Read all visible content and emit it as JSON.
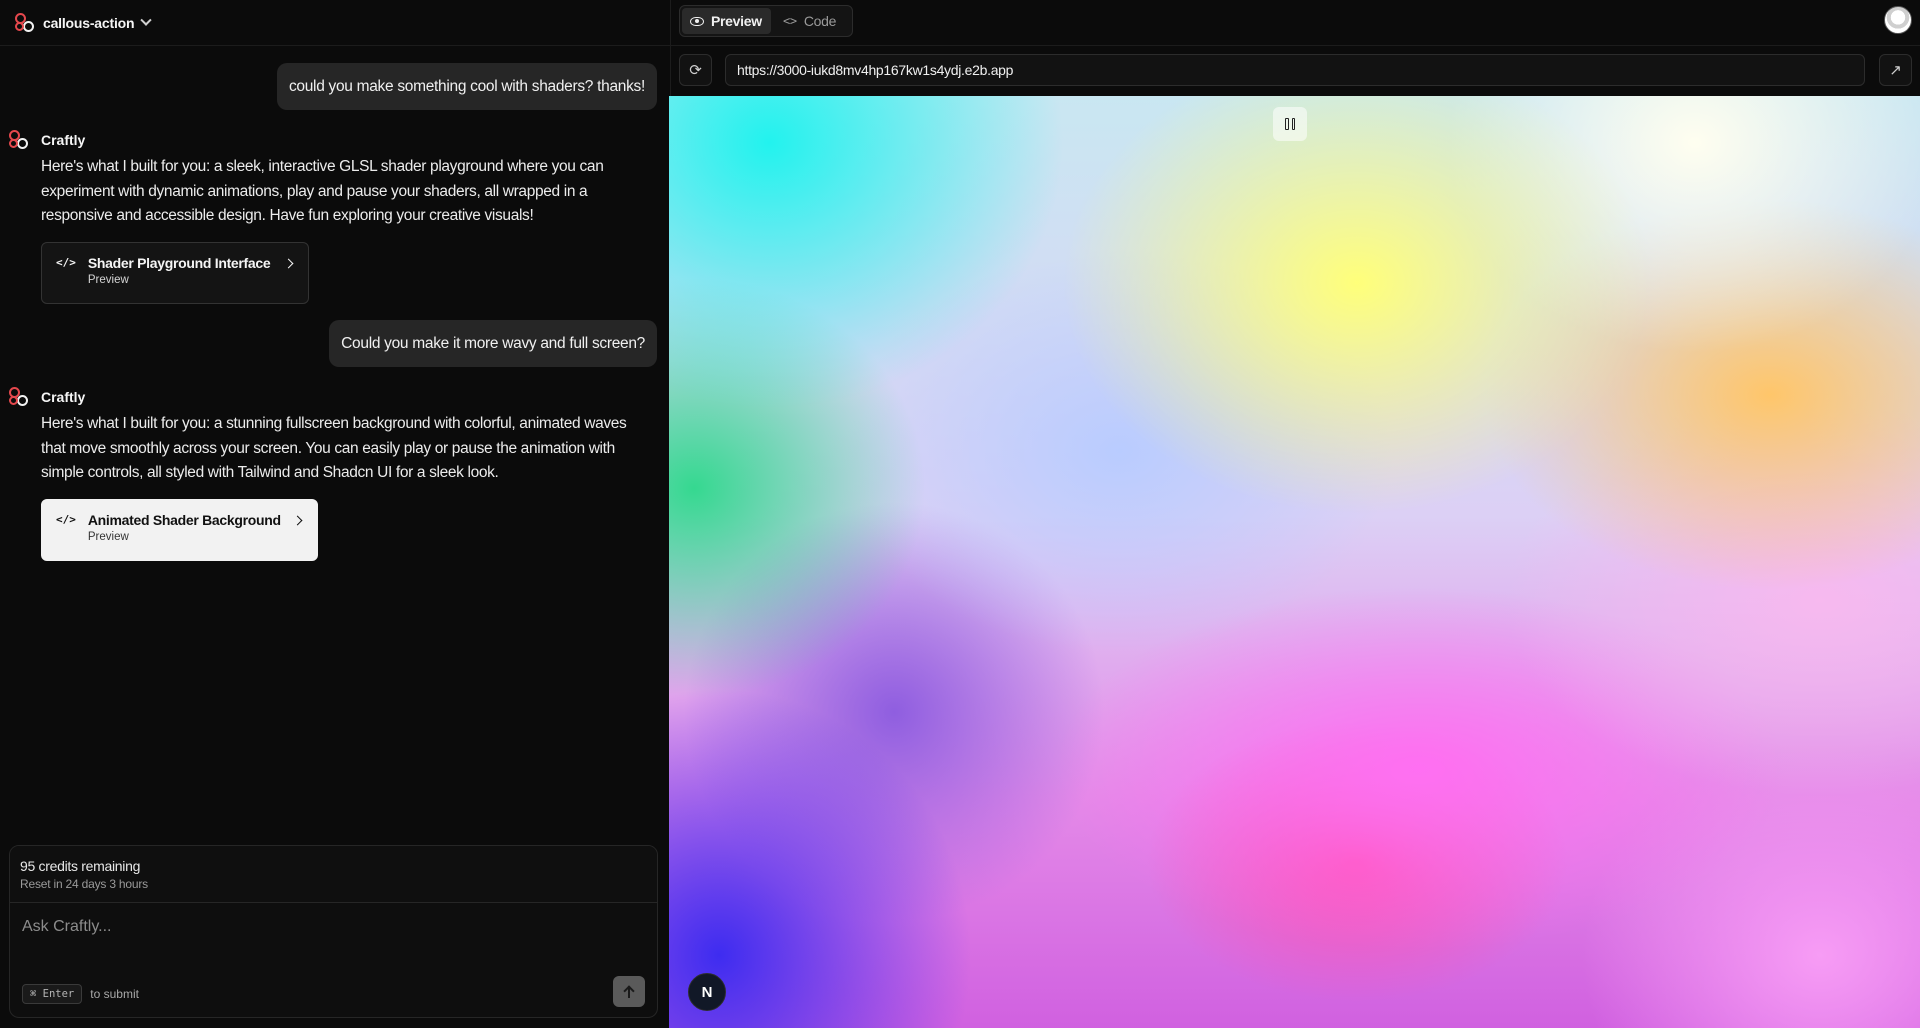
{
  "header": {
    "project_name": "callous-action"
  },
  "chat": {
    "messages": [
      {
        "role": "user",
        "text": "could you make something cool with shaders? thanks!"
      },
      {
        "role": "assistant",
        "name": "Craftly",
        "text": "Here's what I built for you: a sleek, interactive GLSL shader playground where you can experiment with dynamic animations, play and pause your shaders, all wrapped in a responsive and accessible design. Have fun exploring your creative visuals!",
        "card": {
          "title": "Shader Playground Interface",
          "subtitle": "Preview"
        }
      },
      {
        "role": "user",
        "text": "Could you make it more wavy and full screen?"
      },
      {
        "role": "assistant",
        "name": "Craftly",
        "text": "Here's what I built for you: a stunning fullscreen background with colorful, animated waves that move smoothly across your screen. You can easily play or pause the animation with simple controls, all styled with Tailwind and Shadcn UI for a sleek look.",
        "card": {
          "title": "Animated Shader Background",
          "subtitle": "Preview"
        }
      }
    ]
  },
  "composer": {
    "credits": "95 credits remaining",
    "reset": "Reset in 24 days 3 hours",
    "placeholder": "Ask Craftly...",
    "shortcut_key": "⌘ Enter",
    "shortcut_text": "to submit"
  },
  "preview": {
    "tabs": {
      "preview": "Preview",
      "code": "Code"
    },
    "url": "https://3000-iukd8mv4hp167kw1s4ydj.e2b.app",
    "badge": "N"
  },
  "icons": {
    "refresh": "refresh-icon",
    "external": "external-link-icon",
    "pause": "pause-icon",
    "send": "arrow-up-icon"
  },
  "colors": {
    "brand": "#e5484d",
    "panel_bg": "#0b0b0b",
    "bubble_bg": "#262626"
  }
}
